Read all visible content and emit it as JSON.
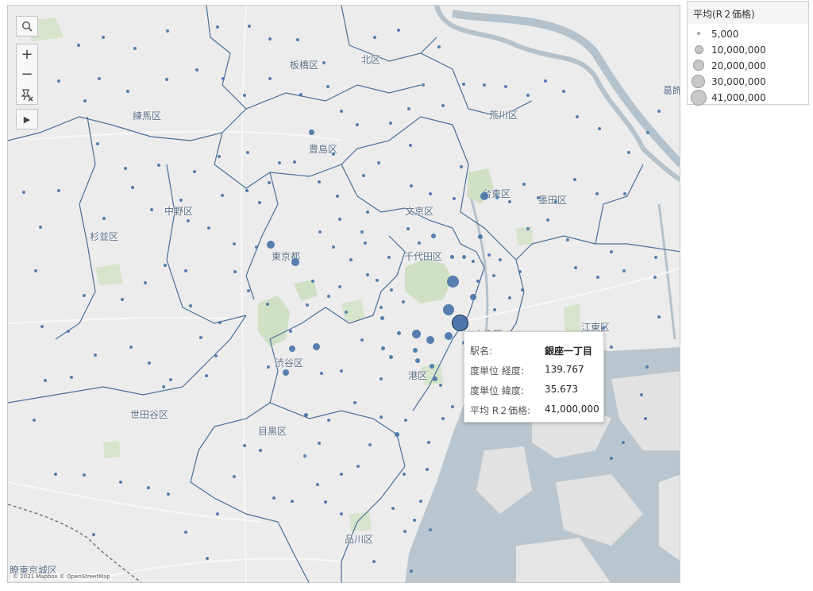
{
  "map": {
    "attribution": "© 2021 Mapbox © OpenStreetMap",
    "colors": {
      "land": "#ececec",
      "water": "#b7c4cd",
      "park": "#cfe0c4",
      "border": "#4a6f99",
      "point": "#4e78ab",
      "text": "#5a6e86"
    },
    "labels": {
      "itabashi": "板橋区",
      "kita": "北区",
      "arakawa": "荒川区",
      "nerima": "練馬区",
      "toshima": "豊島区",
      "taito": "台東区",
      "sumida": "墨田区",
      "bunkyo": "文京区",
      "nakano": "中野区",
      "suginami": "杉並区",
      "tokyo": "東京都",
      "chiyoda": "千代田区",
      "chuo": "中央区",
      "koto": "江東区",
      "shibuya": "渋谷区",
      "minato": "港区",
      "setagaya": "世田谷区",
      "meguro": "目黒区",
      "shinagawa": "品川区",
      "katsushika": "葛飾",
      "bottom_left": "瞭東京城区"
    }
  },
  "controls": {
    "search_icon": "search-icon",
    "zoom_in": "+",
    "zoom_out": "−",
    "pin_icon": "pin-off-icon",
    "play": "▶"
  },
  "tooltip": {
    "station_label": "駅名:",
    "station_value": "銀座一丁目",
    "lon_label": "度単位 経度:",
    "lon_value": "139.767",
    "lat_label": "度単位 緯度:",
    "lat_value": "35.673",
    "price_label": "平均 R２価格:",
    "price_value": "41,000,000"
  },
  "legend": {
    "title": "平均(R２価格)",
    "items": [
      {
        "label": "5,000",
        "value": 5000
      },
      {
        "label": "10,000,000",
        "value": 10000000
      },
      {
        "label": "20,000,000",
        "value": 20000000
      },
      {
        "label": "30,000,000",
        "value": 30000000
      },
      {
        "label": "41,000,000",
        "value": 41000000
      }
    ]
  }
}
